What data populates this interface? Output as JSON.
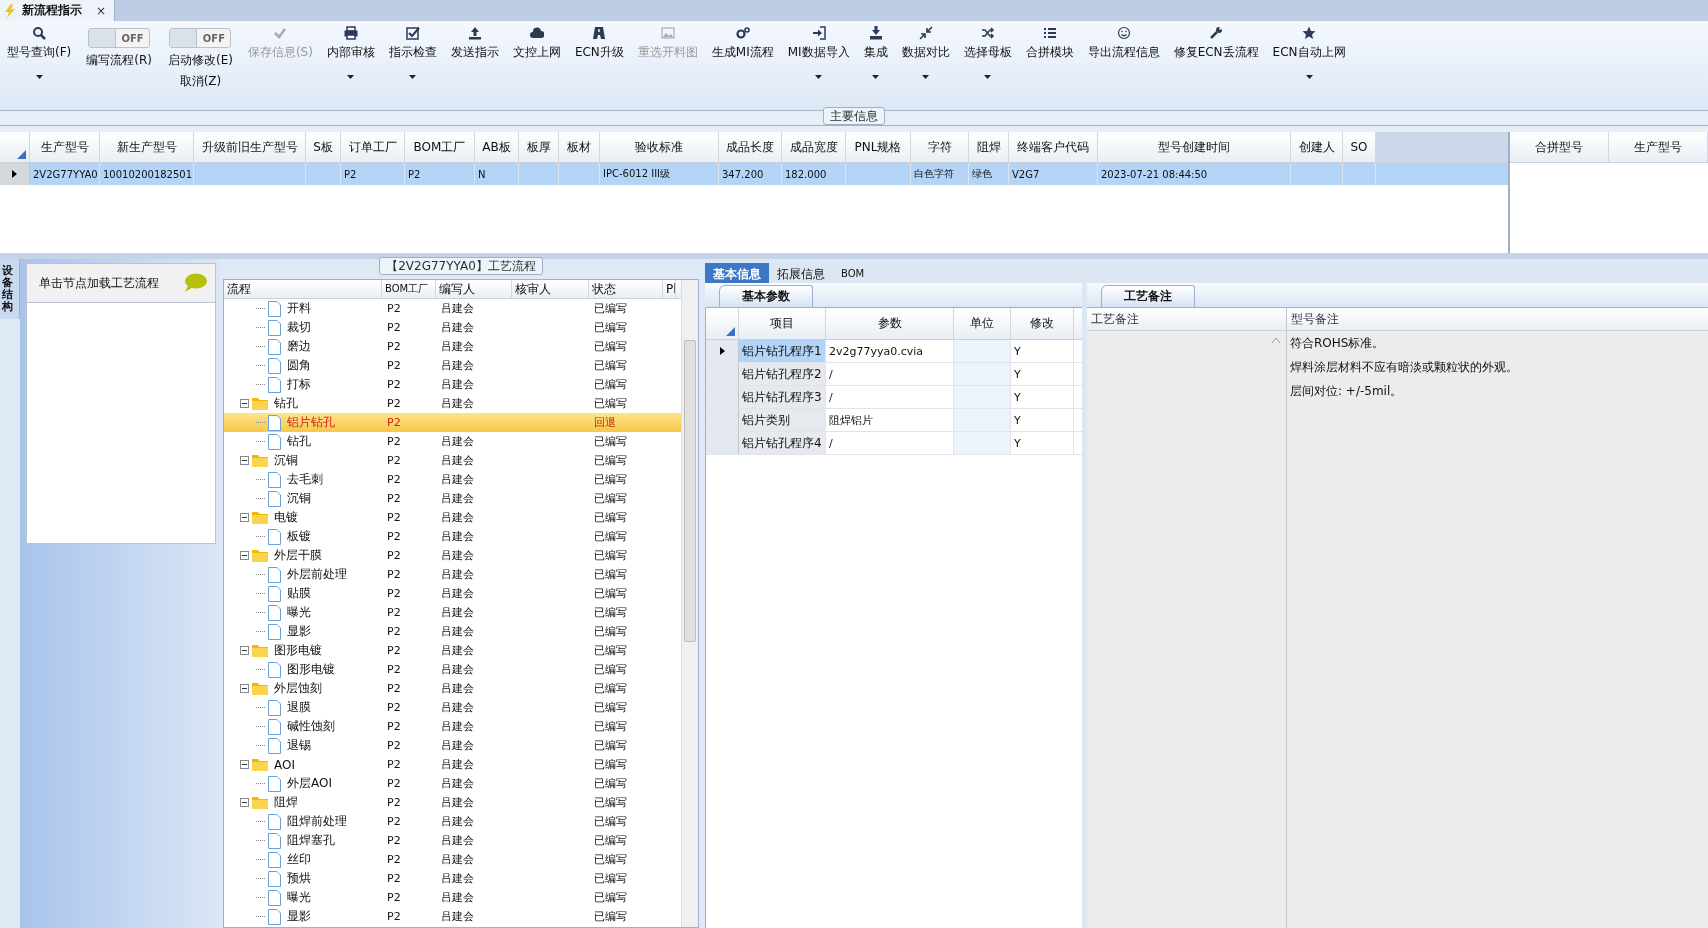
{
  "document_tab": {
    "title": "新流程指示",
    "close": "×",
    "selected": true
  },
  "toolbar": [
    {
      "kind": "button",
      "label": "型号查询(F)",
      "disabled": false,
      "dropdown": true
    },
    {
      "kind": "toggle",
      "label": "编写流程(R)",
      "switch_text": "OFF",
      "on": false
    },
    {
      "kind": "toggle",
      "label": "启动修改(E)",
      "sublabel": "取消(Z)",
      "switch_text": "OFF",
      "on": false
    },
    {
      "kind": "button",
      "label": "保存信息(S)",
      "disabled": true,
      "dropdown": false
    },
    {
      "kind": "button",
      "label": "内部审核",
      "disabled": false,
      "dropdown": true
    },
    {
      "kind": "button",
      "label": "指示检查",
      "disabled": false,
      "dropdown": true
    },
    {
      "kind": "button",
      "label": "发送指示",
      "disabled": false,
      "dropdown": false
    },
    {
      "kind": "button",
      "label": "文控上网",
      "disabled": false,
      "dropdown": false
    },
    {
      "kind": "button",
      "label": "ECN升级",
      "disabled": false,
      "dropdown": false
    },
    {
      "kind": "button",
      "label": "重选开料图",
      "disabled": true,
      "dropdown": false
    },
    {
      "kind": "button",
      "label": "生成MI流程",
      "disabled": false,
      "dropdown": false
    },
    {
      "kind": "button",
      "label": "MI数据导入",
      "disabled": false,
      "dropdown": true
    },
    {
      "kind": "button",
      "label": "集成",
      "disabled": false,
      "dropdown": true
    },
    {
      "kind": "button",
      "label": "数据对比",
      "disabled": false,
      "dropdown": true
    },
    {
      "kind": "button",
      "label": "选择母板",
      "disabled": false,
      "dropdown": true
    },
    {
      "kind": "button",
      "label": "合拼模块",
      "disabled": false,
      "dropdown": false
    },
    {
      "kind": "button",
      "label": "导出流程信息",
      "disabled": false,
      "dropdown": false
    },
    {
      "kind": "button",
      "label": "修复ECN丢流程",
      "disabled": false,
      "dropdown": false
    },
    {
      "kind": "button",
      "label": "ECN自动上网",
      "disabled": false,
      "dropdown": true
    }
  ],
  "main_info": {
    "title": "主要信息",
    "columns": [
      "生产型号",
      "新生产型号",
      "升级前旧生产型号",
      "S板",
      "订单工厂",
      "BOM工厂",
      "AB板",
      "板厚",
      "板材",
      "验收标准",
      "成品长度",
      "成品宽度",
      "PNL规格",
      "字符",
      "阻焊",
      "终端客户代码",
      "型号创建时间",
      "创建人",
      "SO"
    ],
    "rows": [
      {
        "selected": true,
        "cells": [
          "2V2G77YYA0",
          "10010200182501",
          "",
          "",
          "P2",
          "P2",
          "N",
          "",
          "",
          "IPC-6012 III级",
          "347.200",
          "182.000",
          "",
          "白色字符",
          "绿色",
          "V2G7",
          "2023-07-21 08:44:50",
          "",
          ""
        ]
      }
    ],
    "merge_columns": [
      "合拼型号",
      "生产型号"
    ]
  },
  "side_tab": {
    "label": "设备结构"
  },
  "left_panel": {
    "hint": "单击节点加载工艺流程"
  },
  "process_tree": {
    "title": "【2V2G77YYA0】工艺流程",
    "columns": [
      "流程",
      "BOM工厂",
      "编写人",
      "核审人",
      "状态",
      "Pl"
    ],
    "nodes": [
      {
        "children": [
          {
            "label": "开料",
            "bom": "P2",
            "writer": "吕建会",
            "status": "已编写",
            "selected": false
          },
          {
            "label": "裁切",
            "bom": "P2",
            "writer": "吕建会",
            "status": "已编写",
            "selected": false
          },
          {
            "label": "磨边",
            "bom": "P2",
            "writer": "吕建会",
            "status": "已编写",
            "selected": false
          },
          {
            "label": "圆角",
            "bom": "P2",
            "writer": "吕建会",
            "status": "已编写",
            "selected": false
          },
          {
            "label": "打标",
            "bom": "P2",
            "writer": "吕建会",
            "status": "已编写",
            "selected": false
          }
        ]
      },
      {
        "label": "钻孔",
        "bom": "P2",
        "writer": "吕建会",
        "status": "已编写",
        "selected": false,
        "expanded": true,
        "children": [
          {
            "label": "铝片钻孔",
            "bom": "P2",
            "status": "回退",
            "selected": true
          },
          {
            "label": "钻孔",
            "bom": "P2",
            "writer": "吕建会",
            "status": "已编写",
            "selected": false
          }
        ]
      },
      {
        "label": "沉铜",
        "bom": "P2",
        "writer": "吕建会",
        "status": "已编写",
        "selected": false,
        "expanded": true,
        "children": [
          {
            "label": "去毛刺",
            "bom": "P2",
            "writer": "吕建会",
            "status": "已编写",
            "selected": false
          },
          {
            "label": "沉铜",
            "bom": "P2",
            "writer": "吕建会",
            "status": "已编写",
            "selected": false
          }
        ]
      },
      {
        "label": "电镀",
        "bom": "P2",
        "writer": "吕建会",
        "status": "已编写",
        "selected": false,
        "expanded": true,
        "children": [
          {
            "label": "板镀",
            "bom": "P2",
            "writer": "吕建会",
            "status": "已编写",
            "selected": false
          }
        ]
      },
      {
        "label": "外层干膜",
        "bom": "P2",
        "writer": "吕建会",
        "status": "已编写",
        "selected": false,
        "expanded": true,
        "children": [
          {
            "label": "外层前处理",
            "bom": "P2",
            "writer": "吕建会",
            "status": "已编写",
            "selected": false
          },
          {
            "label": "贴膜",
            "bom": "P2",
            "writer": "吕建会",
            "status": "已编写",
            "selected": false
          },
          {
            "label": "曝光",
            "bom": "P2",
            "writer": "吕建会",
            "status": "已编写",
            "selected": false
          },
          {
            "label": "显影",
            "bom": "P2",
            "writer": "吕建会",
            "status": "已编写",
            "selected": false
          }
        ]
      },
      {
        "label": "图形电镀",
        "bom": "P2",
        "writer": "吕建会",
        "status": "已编写",
        "selected": false,
        "expanded": true,
        "children": [
          {
            "label": "图形电镀",
            "bom": "P2",
            "writer": "吕建会",
            "status": "已编写",
            "selected": false
          }
        ]
      },
      {
        "label": "外层蚀刻",
        "bom": "P2",
        "writer": "吕建会",
        "status": "已编写",
        "selected": false,
        "expanded": true,
        "children": [
          {
            "label": "退膜",
            "bom": "P2",
            "writer": "吕建会",
            "status": "已编写",
            "selected": false
          },
          {
            "label": "碱性蚀刻",
            "bom": "P2",
            "writer": "吕建会",
            "status": "已编写",
            "selected": false
          },
          {
            "label": "退锡",
            "bom": "P2",
            "writer": "吕建会",
            "status": "已编写",
            "selected": false
          }
        ]
      },
      {
        "label": "AOI",
        "bom": "P2",
        "writer": "吕建会",
        "status": "已编写",
        "selected": false,
        "expanded": true,
        "children": [
          {
            "label": "外层AOI",
            "bom": "P2",
            "writer": "吕建会",
            "status": "已编写",
            "selected": false
          }
        ]
      },
      {
        "label": "阻焊",
        "bom": "P2",
        "writer": "吕建会",
        "status": "已编写",
        "selected": false,
        "expanded": true,
        "children": [
          {
            "label": "阻焊前处理",
            "bom": "P2",
            "writer": "吕建会",
            "status": "已编写",
            "selected": false
          },
          {
            "label": "阻焊塞孔",
            "bom": "P2",
            "writer": "吕建会",
            "status": "已编写",
            "selected": false
          },
          {
            "label": "丝印",
            "bom": "P2",
            "writer": "吕建会",
            "status": "已编写",
            "selected": false
          },
          {
            "label": "预烘",
            "bom": "P2",
            "writer": "吕建会",
            "status": "已编写",
            "selected": false
          },
          {
            "label": "曝光",
            "bom": "P2",
            "writer": "吕建会",
            "status": "已编写",
            "selected": false
          },
          {
            "label": "显影",
            "bom": "P2",
            "writer": "吕建会",
            "status": "已编写",
            "selected": false
          }
        ]
      }
    ]
  },
  "detail_tabs": [
    {
      "label": "基本信息",
      "selected": true
    },
    {
      "label": "拓展信息",
      "selected": false
    },
    {
      "label": "BOM",
      "selected": false
    }
  ],
  "basic_params": {
    "title": "基本参数",
    "columns": [
      "项目",
      "参数",
      "单位",
      "修改"
    ],
    "rows": [
      {
        "item": "铝片钻孔程序1",
        "value": "2v2g77yya0.cvia",
        "modify": "Y",
        "selected": true
      },
      {
        "item": "铝片钻孔程序2",
        "value": "/",
        "modify": "Y",
        "selected": false
      },
      {
        "item": "铝片钻孔程序3",
        "value": "/",
        "modify": "Y",
        "selected": false
      },
      {
        "item": "铝片类别",
        "value": "阻焊铝片",
        "modify": "Y",
        "selected": false
      },
      {
        "item": "铝片钻孔程序4",
        "value": "/",
        "modify": "Y",
        "selected": false
      }
    ]
  },
  "process_notes": {
    "title": "工艺备注",
    "columns": [
      "工艺备注",
      "型号备注"
    ],
    "model_notes": [
      "符合ROHS标准。",
      "焊料涂层材料不应有暗淡或颗粒状的外观。",
      "层间对位: +/-5mil。"
    ]
  }
}
